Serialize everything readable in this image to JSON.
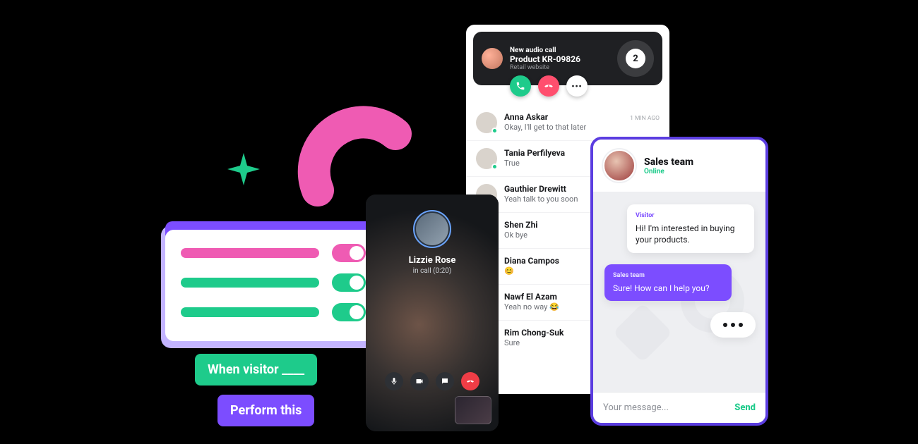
{
  "colors": {
    "purple": "#7c4dff",
    "green": "#1ecb8b",
    "pink": "#ef5bb3",
    "dark": "#1f2023"
  },
  "decor": {
    "plus_color": "#1ecb8b",
    "arc_color": "#ef5bb3"
  },
  "settings": {
    "rows": [
      {
        "bar": "pink",
        "toggle": "pink",
        "on": true
      },
      {
        "bar": "green",
        "toggle": "green",
        "on": true
      },
      {
        "bar": "green",
        "toggle": "green",
        "on": true
      }
    ]
  },
  "tags": {
    "when": "When visitor ____",
    "perform": "Perform this"
  },
  "videocall": {
    "name": "Lizzie Rose",
    "status": "in call (0:20)"
  },
  "incoming_call": {
    "label": "New audio call",
    "product": "Product KR-09826",
    "site": "Retail website",
    "count": "2"
  },
  "conversations": [
    {
      "name": "Anna Askar",
      "msg": "Okay, I'll get to that later",
      "time": "1 MIN AGO",
      "presence": true
    },
    {
      "name": "Tania Perfilyeva",
      "msg": "True",
      "time": "",
      "presence": true
    },
    {
      "name": "Gauthier Drewitt",
      "msg": "Yeah talk to you soon",
      "time": "",
      "presence": false
    },
    {
      "name": "Shen Zhi",
      "msg": "Ok bye",
      "time": "",
      "presence": false
    },
    {
      "name": "Diana Campos",
      "msg": "😊",
      "time": "",
      "presence": false
    },
    {
      "name": "Nawf El Azam",
      "msg": "Yeah no way 😂",
      "time": "",
      "presence": false
    },
    {
      "name": "Rim Chong-Suk",
      "msg": "Sure",
      "time": "",
      "presence": false
    }
  ],
  "chat": {
    "team_name": "Sales team",
    "status": "Online",
    "visitor_label": "Visitor",
    "visitor_msg": "Hi! I'm interested in buying your products.",
    "sales_label": "Sales team",
    "sales_msg": "Sure! How can I help you?",
    "placeholder": "Your message...",
    "send": "Send"
  }
}
